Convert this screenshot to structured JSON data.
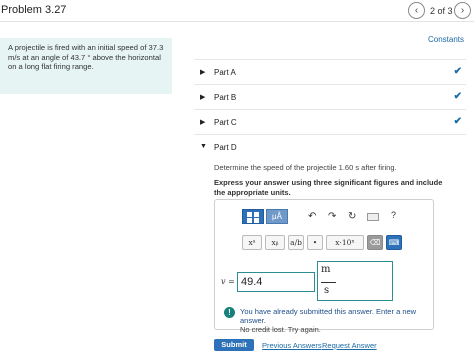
{
  "header": {
    "title": "Problem 3.27",
    "pager": "2 of 3",
    "prev_icon": "‹",
    "next_icon": "›"
  },
  "constants_link": "Constants",
  "problem": {
    "text": "A projectile is fired with an initial speed of 37.3 m/s at an angle of 43.7 ° above the horizontal on a long flat firing range."
  },
  "parts": [
    {
      "label": "Part A",
      "status": "completed",
      "check": "✔"
    },
    {
      "label": "Part B",
      "status": "completed",
      "check": "✔"
    },
    {
      "label": "Part C",
      "status": "completed",
      "check": "✔"
    },
    {
      "label": "Part D",
      "status": "open"
    }
  ],
  "part_d": {
    "question": "Determine the speed of the projectile 1.60 s after firing.",
    "instructions": "Express your answer using three significant figures and include the appropriate units.",
    "toolbar": {
      "templates_icon": "templates-icon",
      "units_label": "μÅ",
      "undo_icon": "↶",
      "redo_icon": "↷",
      "reset_icon": "↻",
      "keyboard_icon": "keyboard-icon",
      "help_label": "?",
      "row2": [
        "xᵃ",
        "xᵦ",
        "a/b",
        "•",
        "x·10ⁿ",
        "⌫",
        "⌨"
      ]
    },
    "variable": "v =",
    "value": "49.4",
    "unit_numerator": "m",
    "unit_denominator": "s",
    "feedback_line1": "You have already submitted this answer. Enter a new answer.",
    "feedback_line2": "No credit lost. Try again.",
    "feedback_icon": "!"
  },
  "actions": {
    "submit": "Submit",
    "previous_answers": "Previous Answers",
    "request_answer": "Request Answer"
  },
  "colors": {
    "accent": "#2d72b8",
    "check": "#1b6ea9",
    "problem_bg": "#e6f5f3",
    "input_border": "#2d8f95",
    "feedback_icon": "#17807a"
  }
}
